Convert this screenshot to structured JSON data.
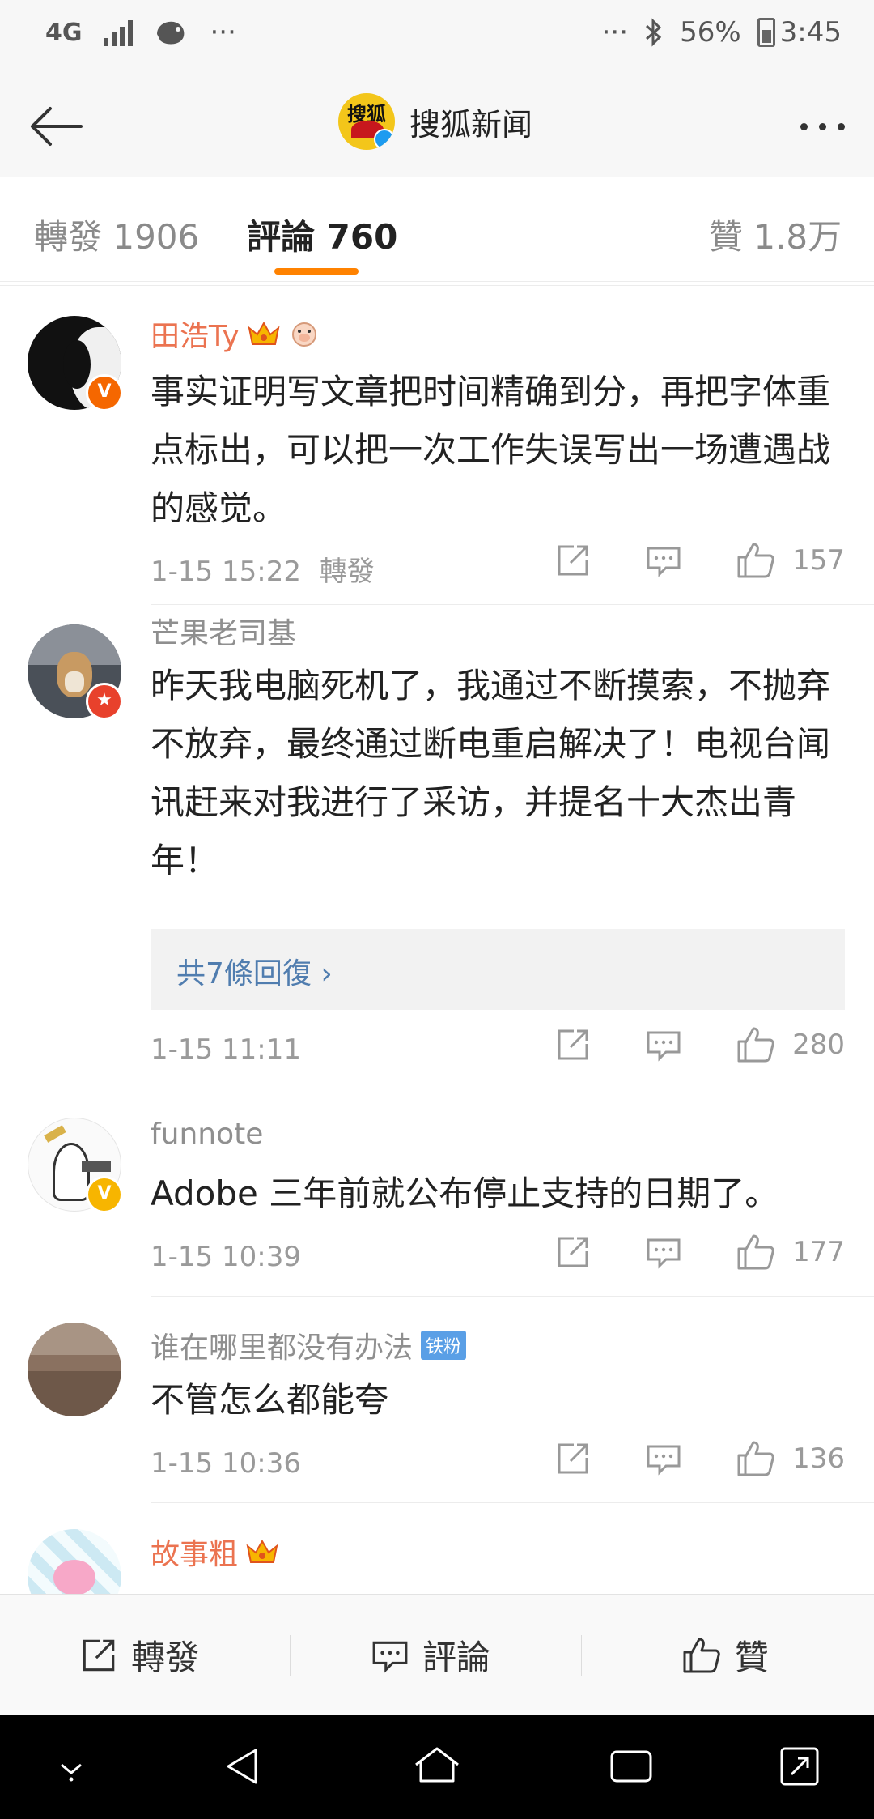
{
  "status_bar": {
    "network": "4G",
    "dots_left": "···",
    "dots_right": "···",
    "battery": "56%",
    "time": "3:45"
  },
  "nav": {
    "back_icon": "back-arrow-icon",
    "avatar_logo_text": "搜狐",
    "title": "搜狐新闻",
    "more_icon": "more-dots-icon"
  },
  "tabs": [
    {
      "label": "轉發 1906"
    },
    {
      "label": "評論 760",
      "active": true
    },
    {
      "label": "贊 1.8万"
    }
  ],
  "comments": [
    {
      "user": "田浩Ty",
      "badge": "V",
      "text": "事实证明写文章把时间精确到分，再把字体重点标出，可以把一次工作失误写出一场遭遇战的感觉。",
      "time": "1-15 15:22",
      "extra": "轉發",
      "likes": "157"
    },
    {
      "user": "芒果老司基",
      "badge": "★",
      "text": "昨天我电脑死机了，我通过不断摸索，不抛弃不放弃，最终通过断电重启解决了！电视台闻讯赶来对我进行了采访，并提名十大杰出青年！",
      "replies": "共7條回復 ›",
      "time": "1-15 11:11",
      "likes": "280"
    },
    {
      "user": "funnote",
      "badge": "V",
      "text": "Adobe 三年前就公布停止支持的日期了。",
      "time": "1-15 10:39",
      "likes": "177"
    },
    {
      "user": "谁在哪里都没有办法",
      "fan_badge": "铁粉",
      "text": "不管怎么都能夸",
      "time": "1-15 10:36",
      "likes": "136"
    },
    {
      "user": "故事粗"
    }
  ],
  "toolbar": {
    "repost": "轉發",
    "comment": "評論",
    "like": "贊"
  },
  "colors": {
    "accent_orange": "#ff8200",
    "vip_name": "#eb7350",
    "link_blue": "#507daf"
  }
}
